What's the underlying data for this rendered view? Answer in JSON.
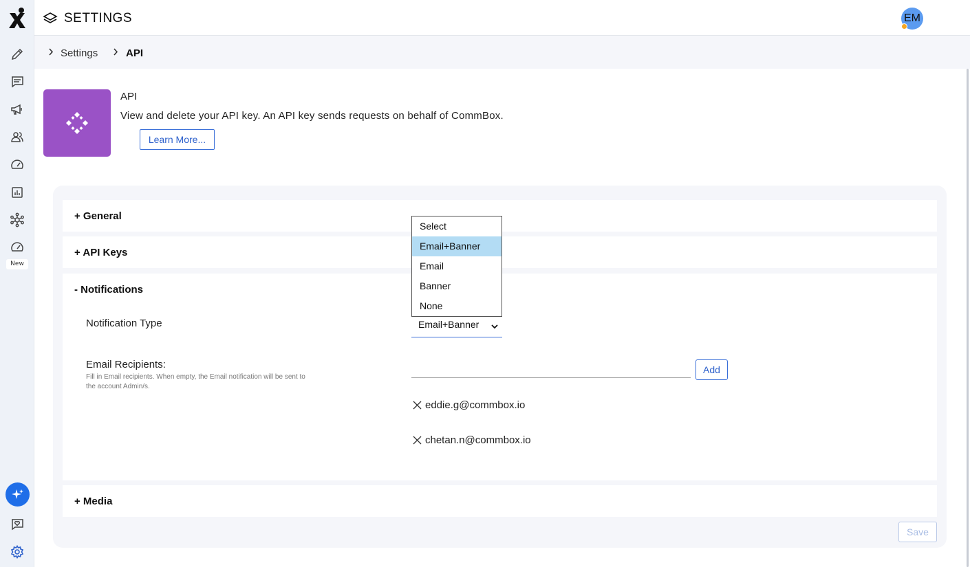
{
  "header": {
    "title": "SETTINGS",
    "avatar_initials": "EM"
  },
  "rail": {
    "new_badge": "New"
  },
  "breadcrumb": {
    "items": [
      "Settings",
      "API"
    ]
  },
  "intro": {
    "title": "API",
    "description": "View and delete your API key. An API key sends requests on behalf of CommBox.",
    "learn_more": "Learn More..."
  },
  "sections": {
    "general": "+ General",
    "api_keys": "+ API Keys",
    "notifications": "- Notifications",
    "media": "+ Media"
  },
  "notifications": {
    "type_label": "Notification Type",
    "type_value": "Email+Banner",
    "options": [
      "Select",
      "Email+Banner",
      "Email",
      "Banner",
      "None"
    ],
    "recipients_label": "Email Recipients:",
    "recipients_hint": "Fill in Email recipients. When empty, the Email notification will be sent to the account Admin/s.",
    "add_label": "Add",
    "recipients": [
      "eddie.g@commbox.io",
      "chetan.n@commbox.io"
    ]
  },
  "footer": {
    "save_label": "Save"
  },
  "colors": {
    "accent": "#2f62cc",
    "tile": "#9a52c6",
    "selected_option": "#b3dcf4"
  }
}
